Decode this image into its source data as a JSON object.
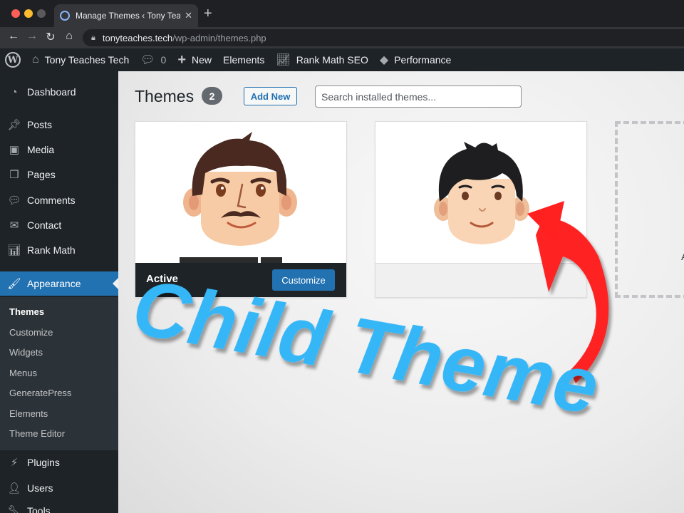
{
  "browser": {
    "tab_title": "Manage Themes ‹ Tony Teache",
    "url_domain": "tonyteaches.tech",
    "url_path": "/wp-admin/themes.php",
    "close_glyph": "✕",
    "new_tab_glyph": "+"
  },
  "admin_bar": {
    "site_name": "Tony Teaches Tech",
    "comment_count": "0",
    "new_label": "New",
    "elements_label": "Elements",
    "rank_math_label": "Rank Math SEO",
    "performance_label": "Performance"
  },
  "sidebar": {
    "items": [
      {
        "label": "Dashboard",
        "icon": "dashboard-icon"
      },
      {
        "label": "Posts",
        "icon": "pushpin-icon"
      },
      {
        "label": "Media",
        "icon": "media-icon"
      },
      {
        "label": "Pages",
        "icon": "pages-icon"
      },
      {
        "label": "Comments",
        "icon": "comment-icon"
      },
      {
        "label": "Contact",
        "icon": "envelope-icon"
      },
      {
        "label": "Rank Math",
        "icon": "chart-icon"
      },
      {
        "label": "Appearance",
        "icon": "paintbrush-icon"
      },
      {
        "label": "Plugins",
        "icon": "plug-icon"
      },
      {
        "label": "Users",
        "icon": "user-icon"
      },
      {
        "label": "Tools",
        "icon": "wrench-icon"
      }
    ],
    "submenu": [
      "Themes",
      "Customize",
      "Widgets",
      "Menus",
      "GeneratePress",
      "Elements",
      "Theme Editor"
    ]
  },
  "main": {
    "title": "Themes",
    "count": "2",
    "add_new": "Add New",
    "search_placeholder": "Search installed themes...",
    "active_label": "Active",
    "customize_label": "Customize",
    "add_theme_partial": "A"
  },
  "overlay": {
    "text": "Child Theme",
    "text_color": "#35b6f7",
    "arrow_color": "#ff2020"
  },
  "colors": {
    "wp_blue": "#2271b1",
    "admin_dark": "#1d2327"
  }
}
